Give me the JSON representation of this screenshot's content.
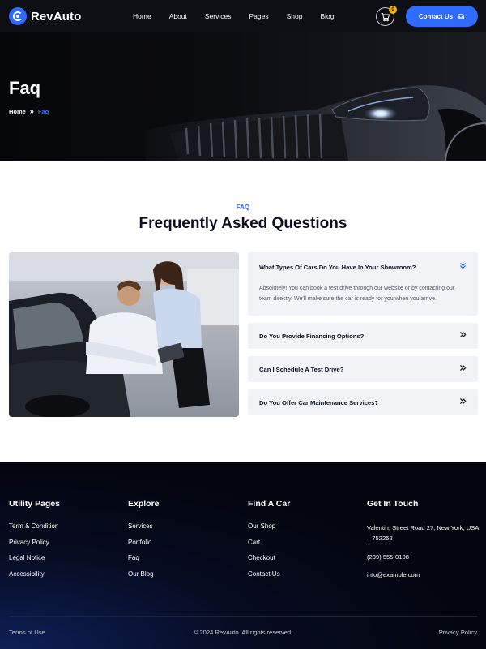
{
  "brand": {
    "name": "RevAuto",
    "accent_color": "#2f6bff"
  },
  "nav": {
    "items": [
      "Home",
      "About",
      "Services",
      "Pages",
      "Shop",
      "Blog"
    ]
  },
  "cart": {
    "icon": "cart-icon",
    "count": "0"
  },
  "header_button": {
    "label": "Contact Us",
    "icon": "car-icon"
  },
  "hero": {
    "title": "Faq",
    "breadcrumb": {
      "home": "Home",
      "current": "Faq"
    }
  },
  "faq_section": {
    "eyebrow": "FAQ",
    "title": "Frequently Asked Questions",
    "items": [
      {
        "question": "What Types Of Cars Do You Have In Your Showroom?",
        "answer": "Absolutely! You can book a test drive through our website or by contacting our team directly. We'll make sure the car is ready for you when you arrive.",
        "expanded": true
      },
      {
        "question": "Do You Provide Financing Options?",
        "expanded": false
      },
      {
        "question": "Can I Schedule A Test Drive?",
        "expanded": false
      },
      {
        "question": "Do You Offer Car Maintenance Services?",
        "expanded": false
      }
    ]
  },
  "footer": {
    "columns": [
      {
        "heading": "Utility Pages",
        "links": [
          "Term & Condition",
          "Privacy Policy",
          "Legal Notice",
          "Accessibility"
        ]
      },
      {
        "heading": "Explore",
        "links": [
          "Services",
          "Portfolio",
          "Faq",
          "Our Blog"
        ]
      },
      {
        "heading": "Find A Car",
        "links": [
          "Our Shop",
          "Cart",
          "Checkout",
          "Contact Us"
        ]
      }
    ],
    "contact": {
      "heading": "Get In Touch",
      "address": "Valentin, Street Road 27, New York, USA – 752252",
      "phone": "(239) 555-0108",
      "email": "info@example.com"
    },
    "bottom": {
      "terms": "Terms of Use",
      "copyright": "© 2024 RevAuto. All rights reserved.",
      "privacy": "Privacy Policy"
    }
  }
}
